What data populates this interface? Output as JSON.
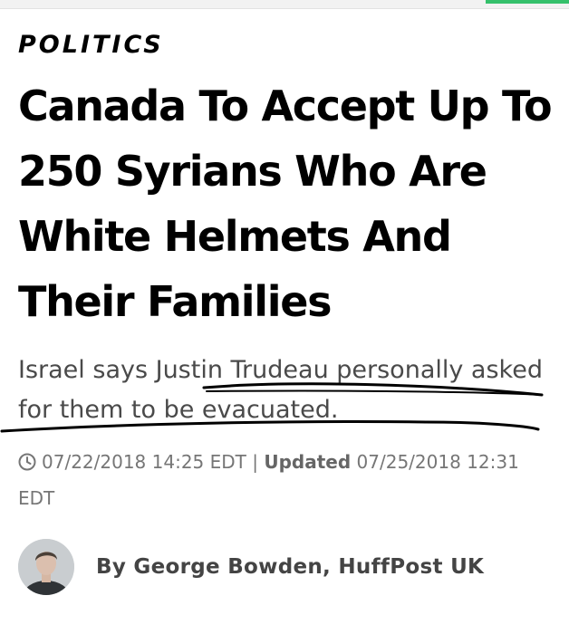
{
  "section": "POLITICS",
  "headline": "Canada To Accept Up To 250 Syrians Who Are White Helmets And Their Families",
  "subheadline": "Israel says Justin Trudeau personally asked for them to be evacuated.",
  "timestamp": {
    "published": "07/22/2018 14:25 EDT",
    "separator": "|",
    "updated_label": "Updated",
    "updated": "07/25/2018 12:31 EDT"
  },
  "byline": "By George Bowden, HuffPost UK",
  "icons": {
    "clock": "clock-icon",
    "avatar": "author-avatar"
  },
  "colors": {
    "accent": "#35c06b",
    "text": "#000000",
    "muted": "#767676",
    "subhead": "#4a4a4a"
  }
}
